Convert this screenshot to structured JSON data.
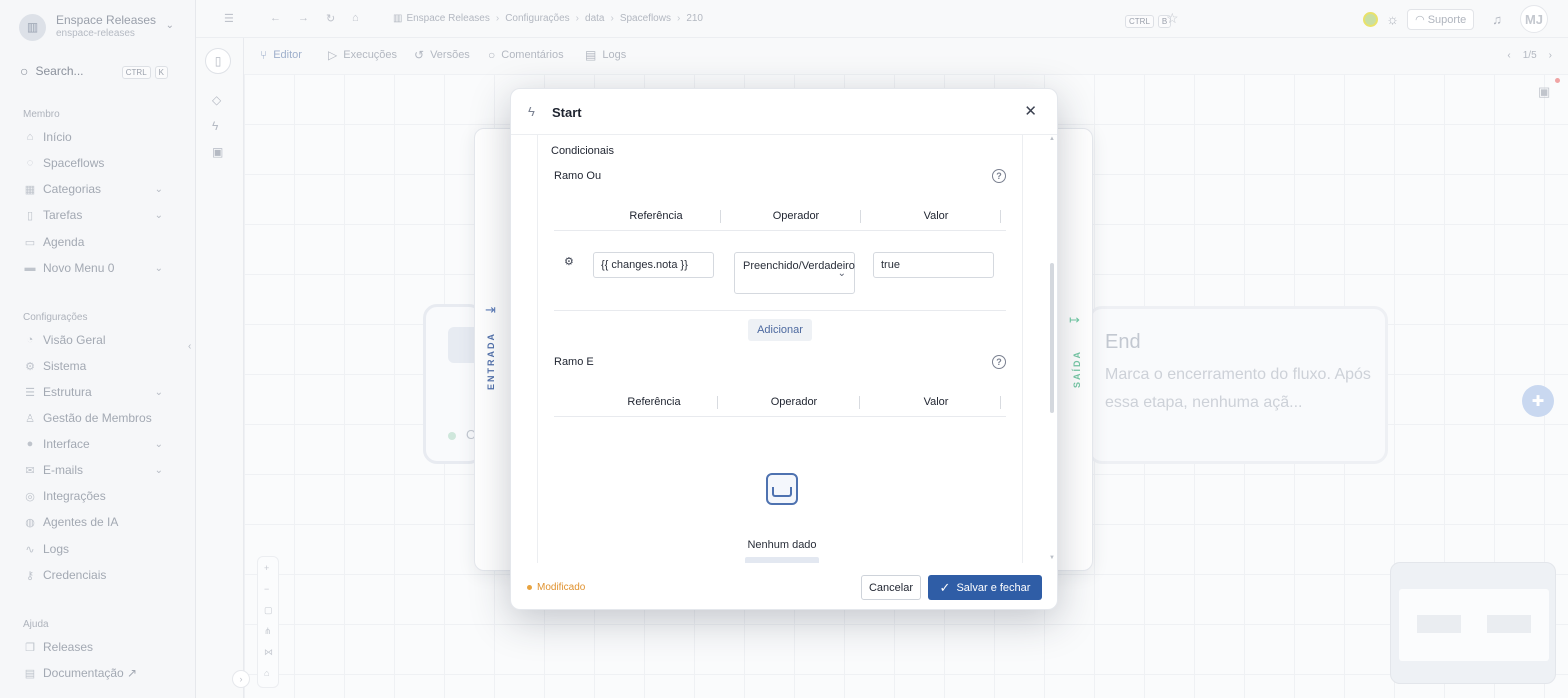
{
  "workspace": {
    "name": "Enspace Releases",
    "slug": "enspace-releases",
    "initial": "▥"
  },
  "search": {
    "label": "Search...",
    "key1": "CTRL",
    "key2": "K"
  },
  "sidebar": {
    "member_title": "Membro",
    "member_items": [
      {
        "label": "Início",
        "icon": "home-icon"
      },
      {
        "label": "Spaceflows",
        "icon": "spaceflow-icon"
      },
      {
        "label": "Categorias",
        "icon": "grid-icon"
      },
      {
        "label": "Tarefas",
        "icon": "file-icon"
      },
      {
        "label": "Agenda",
        "icon": "calendar-icon"
      },
      {
        "label": "Novo Menu 0",
        "icon": "menu-icon"
      }
    ],
    "config_title": "Configurações",
    "config_items": [
      {
        "label": "Visão Geral",
        "icon": "chart-icon"
      },
      {
        "label": "Sistema",
        "icon": "gear-icon"
      },
      {
        "label": "Estrutura",
        "icon": "database-icon"
      },
      {
        "label": "Gestão de Membros",
        "icon": "users-icon"
      },
      {
        "label": "Interface",
        "icon": "palette-icon"
      },
      {
        "label": "E-mails",
        "icon": "mail-icon"
      },
      {
        "label": "Integrações",
        "icon": "plug-icon"
      },
      {
        "label": "Agentes de IA",
        "icon": "bot-icon"
      },
      {
        "label": "Logs",
        "icon": "pulse-icon"
      },
      {
        "label": "Credenciais",
        "icon": "key-icon"
      }
    ],
    "help_title": "Ajuda",
    "help_items": [
      {
        "label": "Releases",
        "icon": "releases-icon"
      },
      {
        "label": "Documentação ↗",
        "icon": "doc-icon"
      }
    ]
  },
  "breadcrumb": [
    "Enspace Releases",
    "Configurações",
    "data",
    "Spaceflows",
    "210"
  ],
  "topbar": {
    "kbd1": "CTRL",
    "kbd2": "B",
    "support": "Suporte",
    "avatar": "MJ"
  },
  "tabs": [
    {
      "label": "Editor",
      "icon": "branch-icon"
    },
    {
      "label": "Execuções",
      "icon": "play-icon"
    },
    {
      "label": "Versões",
      "icon": "history-icon"
    },
    {
      "label": "Comentários",
      "icon": "comment-icon"
    },
    {
      "label": "Logs",
      "icon": "list-icon"
    }
  ],
  "pager": {
    "text": "1/5"
  },
  "canvas": {
    "start_letter": "O",
    "end_title": "End",
    "end_desc": "Marca o encerramento do fluxo. Após essa etapa, nenhuma açã..."
  },
  "side_labels": {
    "entrada": "ENTRADA",
    "saida": "SAÍDA"
  },
  "modal": {
    "title": "Start",
    "section_title": "Condicionais",
    "branch_or": {
      "title": "Ramo Ou",
      "columns": [
        "Referência",
        "Operador",
        "Valor"
      ],
      "row": {
        "reference": "{{ changes.nota }}",
        "operator": "Preenchido/Verdadeiro",
        "value": "true"
      },
      "add_label": "Adicionar"
    },
    "branch_and": {
      "title": "Ramo E",
      "columns": [
        "Referência",
        "Operador",
        "Valor"
      ],
      "empty_text": "Nenhum dado"
    },
    "status": "Modificado",
    "cancel_label": "Cancelar",
    "save_label": "Salvar e fechar"
  }
}
